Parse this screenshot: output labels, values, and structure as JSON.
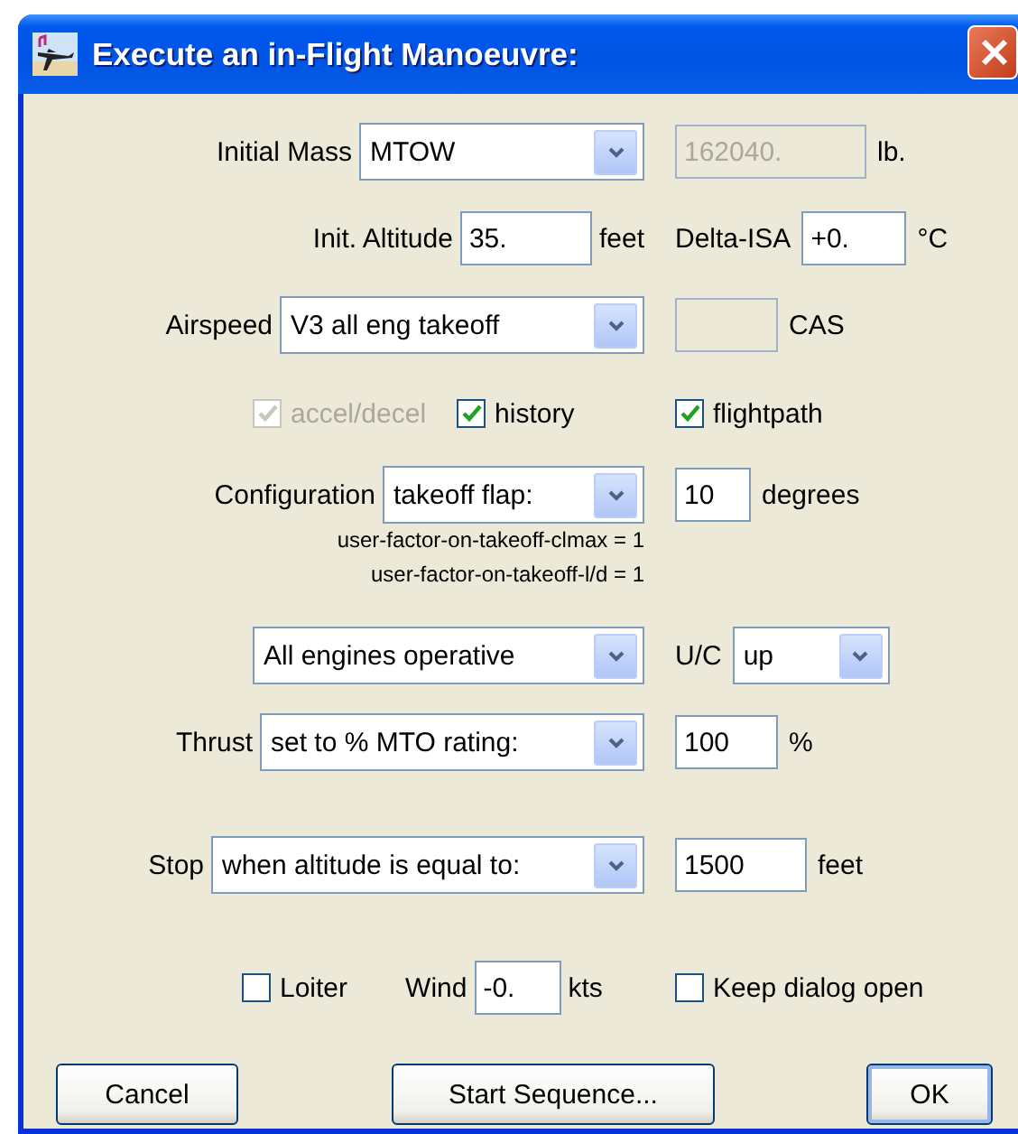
{
  "window": {
    "title": "Execute an in-Flight Manoeuvre:"
  },
  "rows": [
    {
      "left": [
        {
          "kind": "label",
          "text": "Initial Mass"
        },
        {
          "kind": "combo",
          "value": "MTOW"
        }
      ],
      "right": [
        {
          "kind": "field",
          "value": "162040.",
          "disabled": true
        },
        {
          "kind": "label",
          "text": "lb."
        }
      ]
    },
    {
      "left": [
        {
          "kind": "label",
          "text": "Init. Altitude"
        },
        {
          "kind": "field",
          "value": "35.",
          "disabled": false
        },
        {
          "kind": "label",
          "text": "feet"
        }
      ],
      "right": [
        {
          "kind": "label",
          "text": "Delta-ISA"
        },
        {
          "kind": "field",
          "value": "+0.",
          "disabled": false
        },
        {
          "kind": "label",
          "text": "°C"
        }
      ]
    },
    {
      "left": [
        {
          "kind": "label",
          "text": "Airspeed"
        },
        {
          "kind": "combo",
          "value": "V3 all eng takeoff"
        }
      ],
      "right": [
        {
          "kind": "field",
          "disabled": true
        },
        {
          "kind": "label",
          "text": "CAS"
        }
      ]
    },
    {
      "left": [
        {
          "kind": "check",
          "label": "accel/decel",
          "checked": true,
          "disabled": true
        },
        {
          "kind": "check",
          "label": "history",
          "checked": true,
          "disabled": false
        }
      ],
      "right": [
        {
          "kind": "check",
          "label": "flightpath",
          "checked": true,
          "disabled": false
        }
      ]
    },
    {
      "left": [
        {
          "kind": "label",
          "text": "Configuration"
        },
        {
          "kind": "combo",
          "value": "takeoff flap:"
        }
      ],
      "right": [
        {
          "kind": "field",
          "value": "10",
          "disabled": false
        },
        {
          "kind": "label",
          "text": "degrees"
        }
      ]
    },
    {
      "left": [
        {
          "kind": "note",
          "text": "user-factor-on-takeoff-clmax = 1"
        },
        {
          "kind": "note",
          "text": "user-factor-on-takeoff-l/d = 1"
        }
      ],
      "right": []
    },
    {
      "left": [
        {
          "kind": "combo",
          "value": "All engines operative"
        }
      ],
      "right": [
        {
          "kind": "label",
          "text": "U/C"
        },
        {
          "kind": "combo",
          "value": "up"
        }
      ]
    },
    {
      "left": [
        {
          "kind": "label",
          "text": "Thrust"
        },
        {
          "kind": "combo",
          "value": "set to % MTO rating:"
        }
      ],
      "right": [
        {
          "kind": "field",
          "value": "100",
          "disabled": false
        },
        {
          "kind": "label",
          "text": "%"
        }
      ]
    },
    {
      "left": [
        {
          "kind": "label",
          "text": "Stop"
        },
        {
          "kind": "combo",
          "value": "when altitude is equal to:"
        }
      ],
      "right": [
        {
          "kind": "field",
          "value": "1500",
          "disabled": false
        },
        {
          "kind": "label",
          "text": "feet"
        }
      ]
    },
    {
      "left": [
        {
          "kind": "check",
          "label": "Loiter",
          "checked": false,
          "disabled": false
        },
        {
          "kind": "label",
          "text": "Wind"
        },
        {
          "kind": "field",
          "value": "-0.",
          "disabled": false
        },
        {
          "kind": "label",
          "text": "kts"
        }
      ],
      "right": [
        {
          "kind": "check",
          "label": "Keep dialog open",
          "checked": false,
          "disabled": false
        }
      ]
    }
  ],
  "buttons": [
    {
      "label": "Cancel",
      "default": false
    },
    {
      "label": "Start Sequence...",
      "default": false
    },
    {
      "label": "OK",
      "default": true
    }
  ]
}
